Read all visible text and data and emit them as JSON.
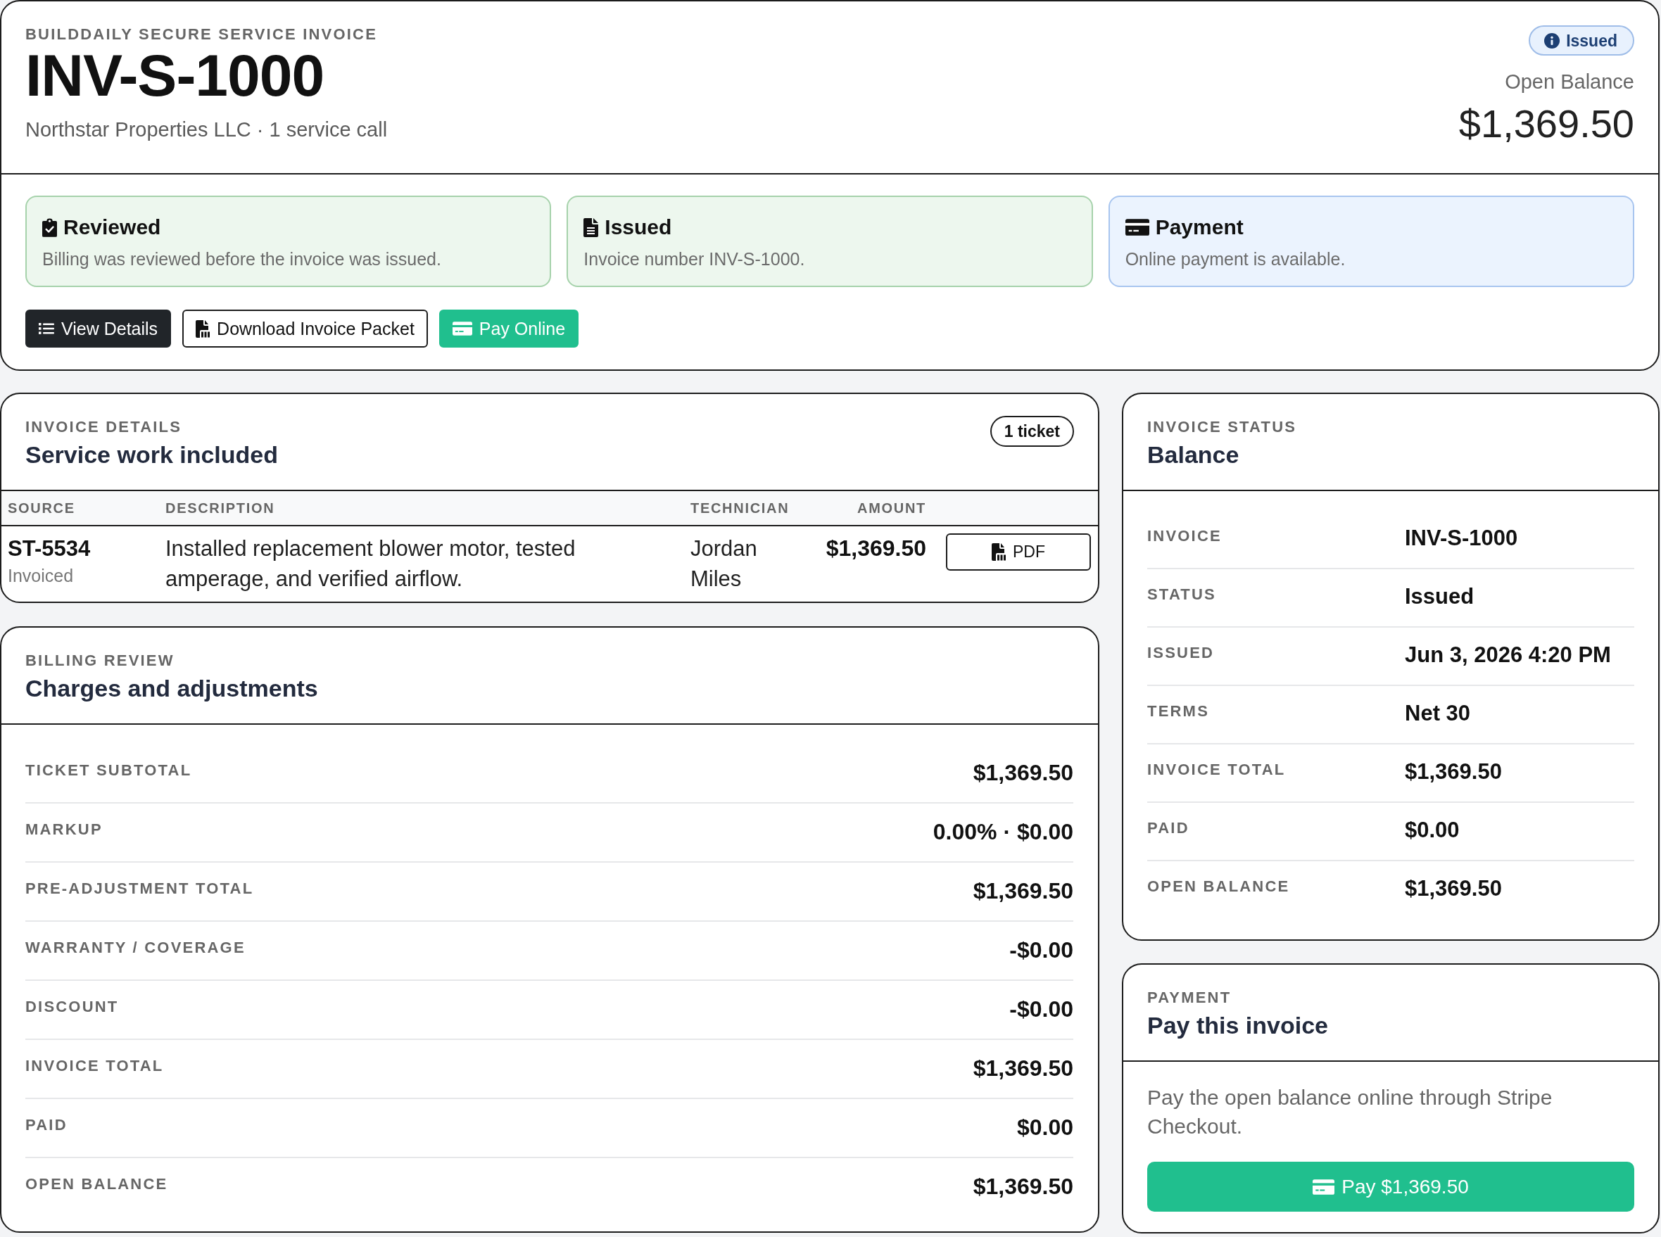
{
  "header": {
    "eyebrow": "BUILDDAILY SECURE SERVICE INVOICE",
    "invoice_number": "INV-S-1000",
    "summary": "Northstar Properties LLC · 1 service call",
    "status_badge": "Issued",
    "balance_label": "Open Balance",
    "balance": "$1,369.50"
  },
  "steps": [
    {
      "kind": "review",
      "title": "Reviewed",
      "text": "Billing was reviewed before the invoice was issued.",
      "done": true
    },
    {
      "kind": "invoice",
      "title": "Issued",
      "text": "Invoice number INV-S-1000.",
      "done": true
    },
    {
      "kind": "payment",
      "title": "Payment",
      "text": "Online payment is available.",
      "done": false
    }
  ],
  "actions": [
    {
      "kind": "details",
      "label": "View Details"
    },
    {
      "kind": "download",
      "label": "Download Invoice Packet"
    },
    {
      "kind": "pay",
      "label": "Pay Online"
    }
  ],
  "invoice_details": {
    "eyebrow": "INVOICE DETAILS",
    "title": "Service work included",
    "count": "1 ticket",
    "columns": [
      "SOURCE",
      "DESCRIPTION",
      "TECHNICIAN",
      "AMOUNT"
    ],
    "rows": [
      {
        "source": "ST-5534",
        "source_status": "Invoiced",
        "description": "Installed replacement blower motor, tested amperage, and verified airflow.",
        "technician": "Jordan Miles",
        "amount": "$1,369.50",
        "action": "PDF"
      }
    ]
  },
  "billing_review": {
    "eyebrow": "BILLING REVIEW",
    "title": "Charges and adjustments",
    "rows": [
      {
        "label": "TICKET SUBTOTAL",
        "value": "$1,369.50"
      },
      {
        "label": "MARKUP",
        "value": "0.00% · $0.00"
      },
      {
        "label": "PRE-ADJUSTMENT TOTAL",
        "value": "$1,369.50"
      },
      {
        "label": "WARRANTY / COVERAGE",
        "value": "-$0.00"
      },
      {
        "label": "DISCOUNT",
        "value": "-$0.00"
      },
      {
        "label": "INVOICE TOTAL",
        "value": "$1,369.50"
      },
      {
        "label": "PAID",
        "value": "$0.00"
      },
      {
        "label": "OPEN BALANCE",
        "value": "$1,369.50"
      }
    ]
  },
  "invoice_status": {
    "eyebrow": "INVOICE STATUS",
    "title": "Balance",
    "rows": [
      {
        "label": "INVOICE",
        "value": "INV-S-1000"
      },
      {
        "label": "STATUS",
        "value": "Issued"
      },
      {
        "label": "ISSUED",
        "value": "Jun 3, 2026 4:20 PM"
      },
      {
        "label": "TERMS",
        "value": "Net 30"
      },
      {
        "label": "INVOICE TOTAL",
        "value": "$1,369.50"
      },
      {
        "label": "PAID",
        "value": "$0.00"
      },
      {
        "label": "OPEN BALANCE",
        "value": "$1,369.50"
      }
    ]
  },
  "payment": {
    "eyebrow": "PAYMENT",
    "title": "Pay this invoice",
    "text": "Pay the open balance online through Stripe Checkout.",
    "button": "Pay $1,369.50"
  }
}
